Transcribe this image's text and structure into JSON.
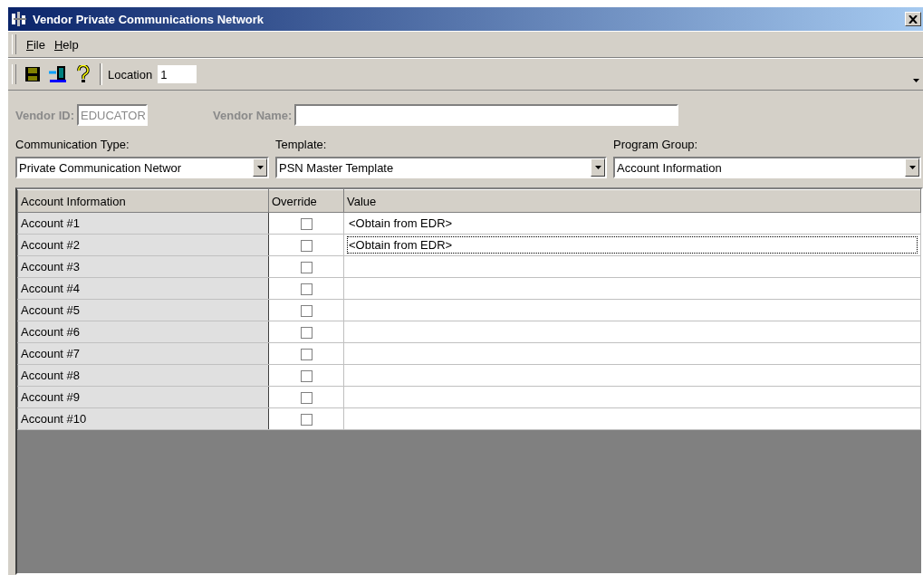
{
  "window": {
    "title": "Vendor Private Communications Network"
  },
  "menu": [
    {
      "label": "File"
    },
    {
      "label": "Help"
    }
  ],
  "toolbar": {
    "location_label": "Location",
    "location_value": "1"
  },
  "vendor": {
    "id_label": "Vendor ID:",
    "id_value": "EDUCATOR",
    "name_label": "Vendor Name:",
    "disabled": true
  },
  "selectors": [
    {
      "label": "Communication Type:",
      "value": "Private Communication Networ"
    },
    {
      "label": "Template:",
      "value": "PSN Master Template"
    },
    {
      "label": "Program Group:",
      "value": "Account Information"
    }
  ],
  "table": {
    "columns": [
      "Account Information",
      "Override",
      "Value"
    ],
    "rows": [
      {
        "name": "Account #1",
        "override": false,
        "value": "<Obtain from EDR>",
        "focused": false
      },
      {
        "name": "Account #2",
        "override": false,
        "value": "<Obtain from EDR>",
        "focused": true
      },
      {
        "name": "Account #3",
        "override": false,
        "value": "",
        "focused": false
      },
      {
        "name": "Account #4",
        "override": false,
        "value": "",
        "focused": false
      },
      {
        "name": "Account #5",
        "override": false,
        "value": "",
        "focused": false
      },
      {
        "name": "Account #6",
        "override": false,
        "value": "",
        "focused": false
      },
      {
        "name": "Account #7",
        "override": false,
        "value": "",
        "focused": false
      },
      {
        "name": "Account #8",
        "override": false,
        "value": "",
        "focused": false
      },
      {
        "name": "Account #9",
        "override": false,
        "value": "",
        "focused": false
      },
      {
        "name": "Account #10",
        "override": false,
        "value": "",
        "focused": false
      }
    ]
  }
}
